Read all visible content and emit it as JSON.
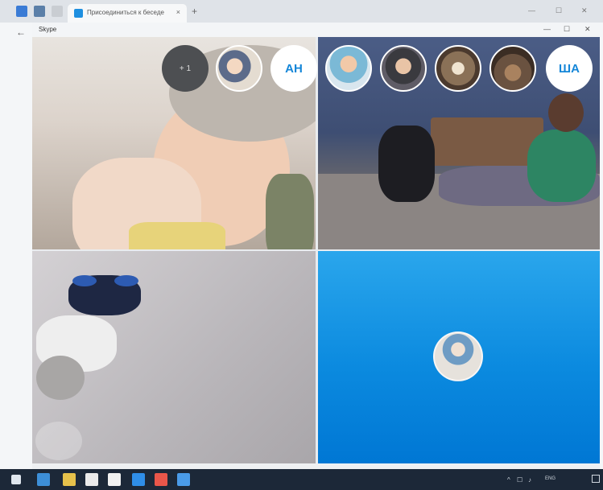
{
  "browser": {
    "tab_title": "Присоединиться к беседе",
    "tab_close": "×",
    "new_tab": "+",
    "window_controls": [
      "—",
      "☐",
      "✕"
    ],
    "back": "←"
  },
  "skype_window": {
    "title": "Skype",
    "controls": [
      "—",
      "☐",
      "✕"
    ]
  },
  "participants_top": {
    "more_label": "+ 1",
    "initials_1": "АН",
    "initials_2": "ША"
  },
  "taskbar": {
    "lang": "ENG",
    "tray_icons": [
      "^",
      "☐",
      "♪"
    ]
  },
  "colors": {
    "skype_blue": "#0b8adf",
    "taskbar": "#1c2838",
    "bubble_dark": "#4d4f52"
  },
  "icons": [
    "back-icon",
    "close-icon",
    "minimize-icon",
    "maximize-icon",
    "windows-start-icon",
    "search-icon",
    "skype-icon",
    "chrome-icon",
    "mail-icon",
    "store-icon",
    "explorer-icon",
    "notification-icon"
  ]
}
